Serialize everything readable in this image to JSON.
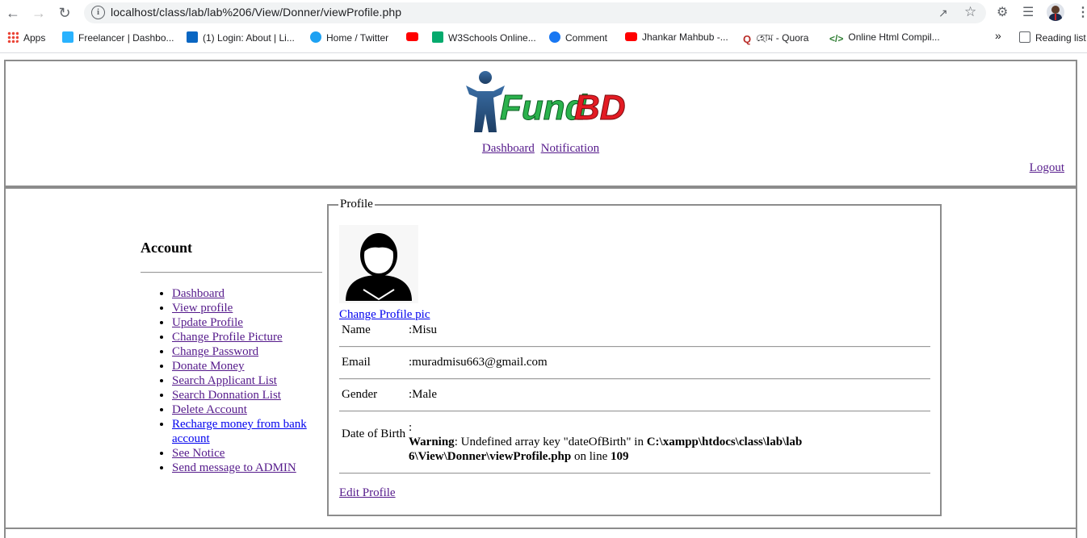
{
  "browser": {
    "url": "localhost/class/lab/lab%206/View/Donner/viewProfile.php",
    "bookmarks": [
      {
        "label": "Apps",
        "color": "#4285f4",
        "icon": "apps-grid-icon"
      },
      {
        "label": "Freelancer | Dashbo...",
        "color": "#29b2fe",
        "icon": "freelancer-icon"
      },
      {
        "label": "(1) Login: About | Li...",
        "color": "#0a66c2",
        "icon": "linkedin-icon"
      },
      {
        "label": "Home / Twitter",
        "color": "#1da1f2",
        "icon": "twitter-icon"
      },
      {
        "label": "",
        "color": "#ff0000",
        "icon": "youtube-icon"
      },
      {
        "label": "W3Schools Online...",
        "color": "#04aa6d",
        "icon": "w3schools-icon"
      },
      {
        "label": "Comment",
        "color": "#1877f2",
        "icon": "facebook-icon"
      },
      {
        "label": "Jhankar Mahbub -...",
        "color": "#ff0000",
        "icon": "youtube-icon"
      },
      {
        "label": "হোম - Quora",
        "color": "#b92b27",
        "icon": "quora-icon"
      },
      {
        "label": "Online Html Compil...",
        "color": "#2e7d32",
        "icon": "code-icon"
      }
    ],
    "overflow": "»",
    "reading_list": "Reading list"
  },
  "header": {
    "logo_text": "FundBD",
    "nav": [
      {
        "label": "Dashboard"
      },
      {
        "label": "Notification"
      }
    ],
    "logout": "Logout"
  },
  "sidebar": {
    "title": "Account",
    "items": [
      {
        "label": "Dashboard",
        "visited": true
      },
      {
        "label": "View profile",
        "visited": true
      },
      {
        "label": "Update Profile",
        "visited": true
      },
      {
        "label": "Change Profile Picture",
        "visited": true
      },
      {
        "label": "Change Password",
        "visited": true
      },
      {
        "label": "Donate Money",
        "visited": true
      },
      {
        "label": "Search Applicant List",
        "visited": true
      },
      {
        "label": "Search Donnation List",
        "visited": true
      },
      {
        "label": "Delete Account",
        "visited": true
      },
      {
        "label": "Recharge money from bank account",
        "visited": false
      },
      {
        "label": "See Notice",
        "visited": true
      },
      {
        "label": "Send message to ADMIN",
        "visited": true
      }
    ]
  },
  "profile": {
    "legend": "Profile",
    "change_pic": "Change Profile pic",
    "fields": {
      "name": {
        "label": "Name",
        "value": ":Misu"
      },
      "email": {
        "label": "Email",
        "value": ":muradmisu663@gmail.com"
      },
      "gender": {
        "label": "Gender",
        "value": ":Male"
      },
      "dob": {
        "label": "Date of Birth",
        "colon": ":",
        "warning_label": "Warning",
        "warning_text": ": Undefined array key \"dateOfBirth\" in ",
        "warning_path": "C:\\xampp\\htdocs\\class\\lab\\lab 6\\View\\Donner\\viewProfile.php",
        "warning_online": " on line ",
        "warning_line": "109"
      }
    },
    "edit": "Edit Profile"
  }
}
